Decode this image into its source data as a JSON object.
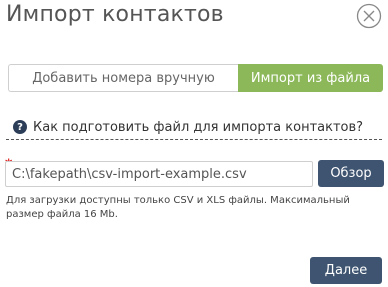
{
  "dialog": {
    "title": "Импорт контактов"
  },
  "tabs": [
    {
      "label": "Добавить номера вручную",
      "active": false
    },
    {
      "label": "Импорт из файла",
      "active": true
    }
  ],
  "help": {
    "icon": "question-circle-icon",
    "text": "Как подготовить файл для импорта контактов?"
  },
  "file_input": {
    "required_mark": "*",
    "value": "C:\\fakepath\\csv-import-example.csv",
    "browse_label": "Обзор"
  },
  "hint": "Для загрузки доступны только CSV и XLS файлы. Максимальный размер файла 16 Mb.",
  "footer": {
    "next_label": "Далее"
  },
  "colors": {
    "active_tab": "#8cb85a",
    "button": "#3e5470",
    "required": "#e02020"
  }
}
